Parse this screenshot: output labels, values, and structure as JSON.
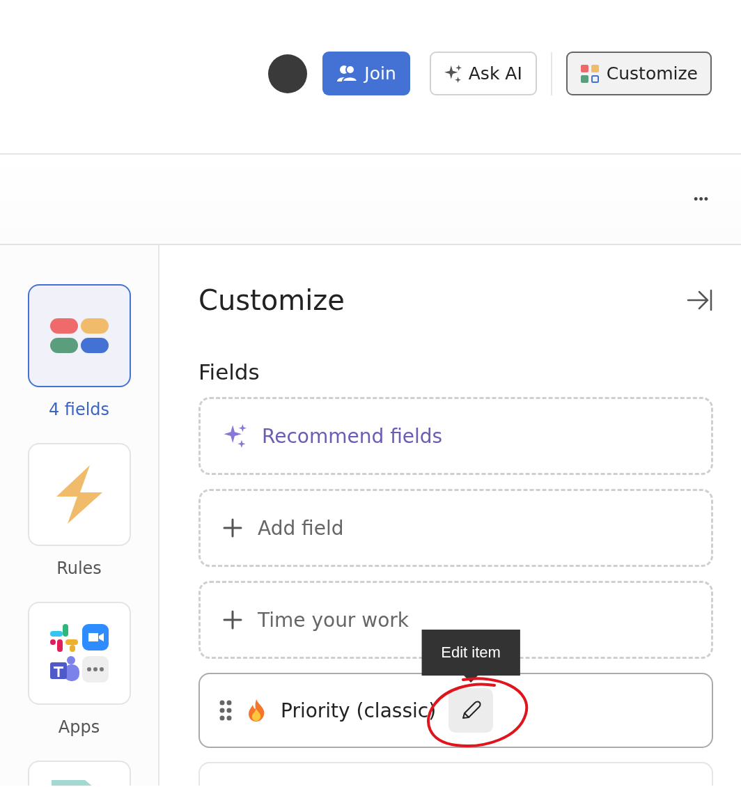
{
  "header": {
    "join_button": "Join",
    "ask_ai_button": "Ask AI",
    "customize_button": {
      "label": "Customize",
      "selected": true
    }
  },
  "toolbar": {
    "more_button": "•••"
  },
  "rail": [
    {
      "kind": "fields",
      "label": "4 fields",
      "selected": true
    },
    {
      "kind": "rules",
      "label": "Rules",
      "selected": false
    },
    {
      "kind": "apps",
      "label": "Apps",
      "selected": false
    },
    {
      "kind": "partial",
      "selected": false
    }
  ],
  "panel": {
    "title": "Customize",
    "section": "Fields",
    "items": [
      {
        "kind": "recommend",
        "label": "Recommend fields"
      },
      {
        "kind": "add",
        "label": "Add field"
      },
      {
        "kind": "add",
        "label": "Time your work"
      },
      {
        "kind": "field",
        "label": "Priority (classic)",
        "tooltip": "Edit item",
        "hovered": true
      },
      {
        "kind": "partial"
      }
    ]
  }
}
